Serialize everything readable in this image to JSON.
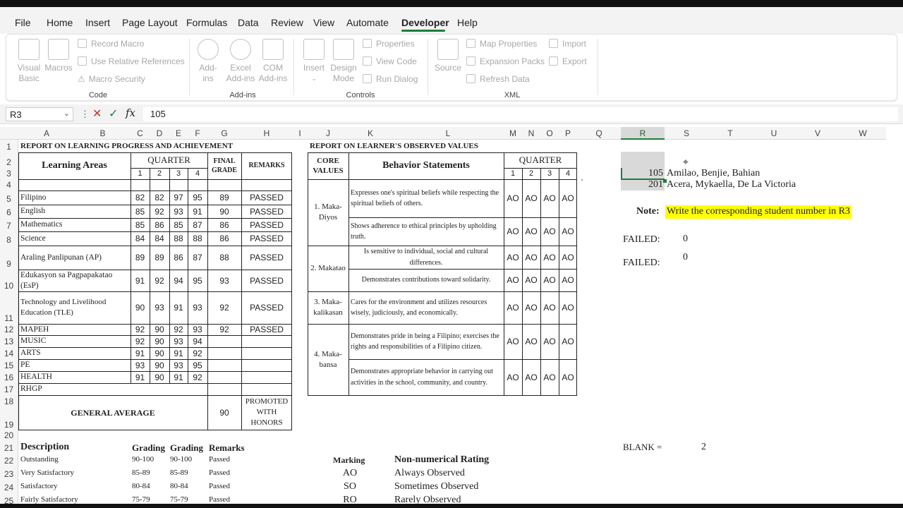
{
  "menu": [
    "File",
    "Home",
    "Insert",
    "Page Layout",
    "Formulas",
    "Data",
    "Review",
    "View",
    "Automate",
    "Developer",
    "Help"
  ],
  "ribbon": {
    "code": {
      "label": "Code",
      "visual_basic": "Visual\nBasic",
      "macros": "Macros",
      "record_macro": "Record Macro",
      "relative_refs": "Use Relative References",
      "macro_security": "Macro Security"
    },
    "addins": {
      "label": "Add-ins",
      "addins": "Add-\nins",
      "excel_addins": "Excel\nAdd-ins",
      "com_addins": "COM\nAdd-ins"
    },
    "controls": {
      "label": "Controls",
      "insert": "Insert",
      "design_mode": "Design\nMode",
      "properties": "Properties",
      "view_code": "View Code",
      "run_dialog": "Run Dialog"
    },
    "xml": {
      "label": "XML",
      "source": "Source",
      "map_properties": "Map Properties",
      "expansion_packs": "Expansion Packs",
      "refresh_data": "Refresh Data",
      "import": "Import",
      "export": "Export"
    }
  },
  "formula_bar": {
    "name_box": "R3",
    "value": "105"
  },
  "columns": [
    "A",
    "B",
    "C",
    "D",
    "E",
    "F",
    "G",
    "H",
    "I",
    "J",
    "K",
    "L",
    "M",
    "N",
    "O",
    "P",
    "Q",
    "R",
    "S",
    "T",
    "U",
    "V",
    "W"
  ],
  "rows": [
    "1",
    "2",
    "3",
    "4",
    "5",
    "6",
    "7",
    "8",
    "9",
    "10",
    "11",
    "12",
    "13",
    "14",
    "15",
    "16",
    "17",
    "18",
    "19",
    "20",
    "21",
    "22",
    "23",
    "24",
    "25"
  ],
  "report_left": {
    "title": "REPORT ON LEARNING PROGRESS AND ACHIEVEMENT",
    "hdr_learning_areas": "Learning Areas",
    "hdr_quarter": "QUARTER",
    "hdr_q": [
      "1",
      "2",
      "3",
      "4"
    ],
    "hdr_final_grade": "FINAL GRADE",
    "hdr_remarks": "REMARKS",
    "subjects": [
      {
        "name": "Filipino",
        "q": [
          "82",
          "82",
          "97",
          "95"
        ],
        "final": "89",
        "remarks": "PASSED"
      },
      {
        "name": "English",
        "q": [
          "85",
          "92",
          "93",
          "91"
        ],
        "final": "90",
        "remarks": "PASSED"
      },
      {
        "name": "Mathematics",
        "q": [
          "85",
          "86",
          "85",
          "87"
        ],
        "final": "86",
        "remarks": "PASSED"
      },
      {
        "name": "Science",
        "q": [
          "84",
          "84",
          "88",
          "88"
        ],
        "final": "86",
        "remarks": "PASSED"
      },
      {
        "name": "Araling Panlipunan (AP)",
        "q": [
          "89",
          "89",
          "86",
          "87"
        ],
        "final": "88",
        "remarks": "PASSED"
      },
      {
        "name": "Edukasyon sa Pagpapakatao (EsP)",
        "q": [
          "91",
          "92",
          "94",
          "95"
        ],
        "final": "93",
        "remarks": "PASSED"
      },
      {
        "name": "Technology and Livelihood Education (TLE)",
        "q": [
          "90",
          "93",
          "91",
          "93"
        ],
        "final": "92",
        "remarks": "PASSED"
      },
      {
        "name": "MAPEH",
        "q": [
          "92",
          "90",
          "92",
          "93"
        ],
        "final": "92",
        "remarks": "PASSED"
      },
      {
        "name": "MUSIC",
        "q": [
          "92",
          "90",
          "93",
          "94"
        ],
        "final": "",
        "remarks": ""
      },
      {
        "name": "ARTS",
        "q": [
          "91",
          "90",
          "91",
          "92"
        ],
        "final": "",
        "remarks": ""
      },
      {
        "name": "PE",
        "q": [
          "93",
          "90",
          "93",
          "95"
        ],
        "final": "",
        "remarks": ""
      },
      {
        "name": "HEALTH",
        "q": [
          "91",
          "90",
          "91",
          "92"
        ],
        "final": "",
        "remarks": ""
      },
      {
        "name": "RHGP",
        "q": [
          "",
          "",
          "",
          ""
        ],
        "final": "",
        "remarks": ""
      }
    ],
    "general_average_label": "GENERAL AVERAGE",
    "general_average": "90",
    "general_remarks": "PROMOTED WITH HONORS"
  },
  "report_right": {
    "title": "REPORT ON LEARNER'S OBSERVED VALUES",
    "hdr_core_values": "CORE VALUES",
    "hdr_behavior": "Behavior Statements",
    "hdr_quarter": "QUARTER",
    "hdr_q": [
      "1",
      "2",
      "3",
      "4"
    ],
    "groups": [
      {
        "core": "1. Maka-Diyos",
        "statements": [
          {
            "text": "Expresses one's spiritual beliefs while respecting the spiritual beliefs of others.",
            "marks": [
              "AO",
              "AO",
              "AO",
              "AO"
            ]
          },
          {
            "text": "Shows adherence to ethical principles by upholding truth.",
            "marks": [
              "AO",
              "AO",
              "AO",
              "AO"
            ]
          }
        ]
      },
      {
        "core": "2. Makatao",
        "statements": [
          {
            "text": "Is sensitive to individual, social and cultural differences.",
            "marks": [
              "AO",
              "AO",
              "AO",
              "AO"
            ]
          },
          {
            "text": "Demonstrates contributions toward solidarity.",
            "marks": [
              "AO",
              "AO",
              "AO",
              "AO"
            ]
          }
        ]
      },
      {
        "core": "3. Maka-kalikasan",
        "statements": [
          {
            "text": "Cares for the environment and utilizes resources wisely, judiciously, and economically.",
            "marks": [
              "AO",
              "AO",
              "AO",
              "AO"
            ]
          }
        ]
      },
      {
        "core": "4. Maka-bansa",
        "statements": [
          {
            "text": "Demonstrates pride in being a Filipino; exercises the rights and responsibilities of a Filipino citizen.",
            "marks": [
              "AO",
              "AO",
              "AO",
              "AO"
            ]
          },
          {
            "text": "Demonstrates appropriate behavior in carrying out activities in the school, community, and country.",
            "marks": [
              "AO",
              "AO",
              "AO",
              "AO"
            ]
          }
        ]
      }
    ]
  },
  "side": {
    "students": [
      {
        "num": "105",
        "name": "Amilao, Benjie, Bahian"
      },
      {
        "num": "201",
        "name": "Acera, Mykaella, De La Victoria"
      }
    ],
    "note_label": "Note:",
    "note_text": "Write the corresponding student number in R3",
    "failed_label": "FAILED:",
    "failed_values": [
      "0",
      "0"
    ],
    "blank_label": "BLANK =",
    "blank_value": "2"
  },
  "legend": {
    "headers": [
      "Description",
      "Grading",
      "Grading",
      "Remarks"
    ],
    "rows": [
      [
        "Outstanding",
        "90-100",
        "90-100",
        "Passed"
      ],
      [
        "Very Satisfactory",
        "85-89",
        "85-89",
        "Passed"
      ],
      [
        "Satisfactory",
        "80-84",
        "80-84",
        "Passed"
      ],
      [
        "Fairly Satisfactory",
        "75-79",
        "75-79",
        "Passed"
      ]
    ],
    "marking_header": "Marking",
    "rating_header": "Non-numerical Rating",
    "marks": [
      [
        "AO",
        "Always Observed"
      ],
      [
        "SO",
        "Sometimes Observed"
      ],
      [
        "RO",
        "Rarely Observed"
      ]
    ]
  },
  "colors": {
    "accent": "#1a7f3c",
    "highlight": "#ffff00",
    "selected": "#d9d9d9"
  }
}
